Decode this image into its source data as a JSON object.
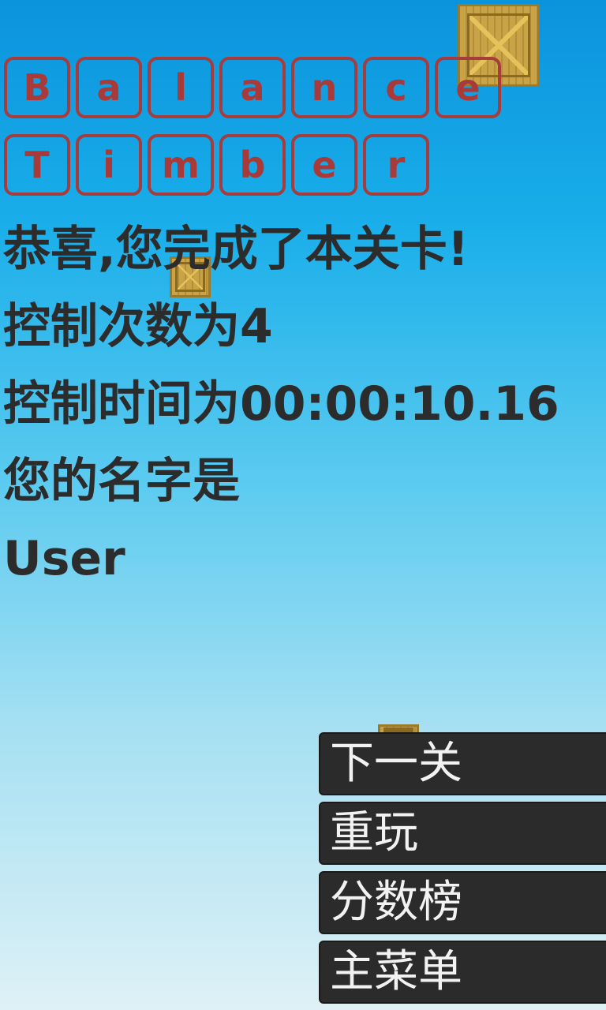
{
  "title": {
    "row1": [
      "B",
      "a",
      "l",
      "a",
      "n",
      "c",
      "e"
    ],
    "row2": [
      "T",
      "i",
      "m",
      "b",
      "e",
      "r"
    ]
  },
  "result": {
    "congrats": "恭喜,您完成了本关卡!",
    "moves": "控制次数为4",
    "time": "控制时间为00:00:10.16",
    "name_prompt": "您的名字是",
    "name_value": "User"
  },
  "menu": {
    "next_level": "下一关",
    "replay": "重玩",
    "leaderboard": "分数榜",
    "main_menu": "主菜单"
  },
  "colors": {
    "tile_border": "#a63c3c",
    "text": "#2c2c2c",
    "button_bg": "#2b2b2b"
  }
}
